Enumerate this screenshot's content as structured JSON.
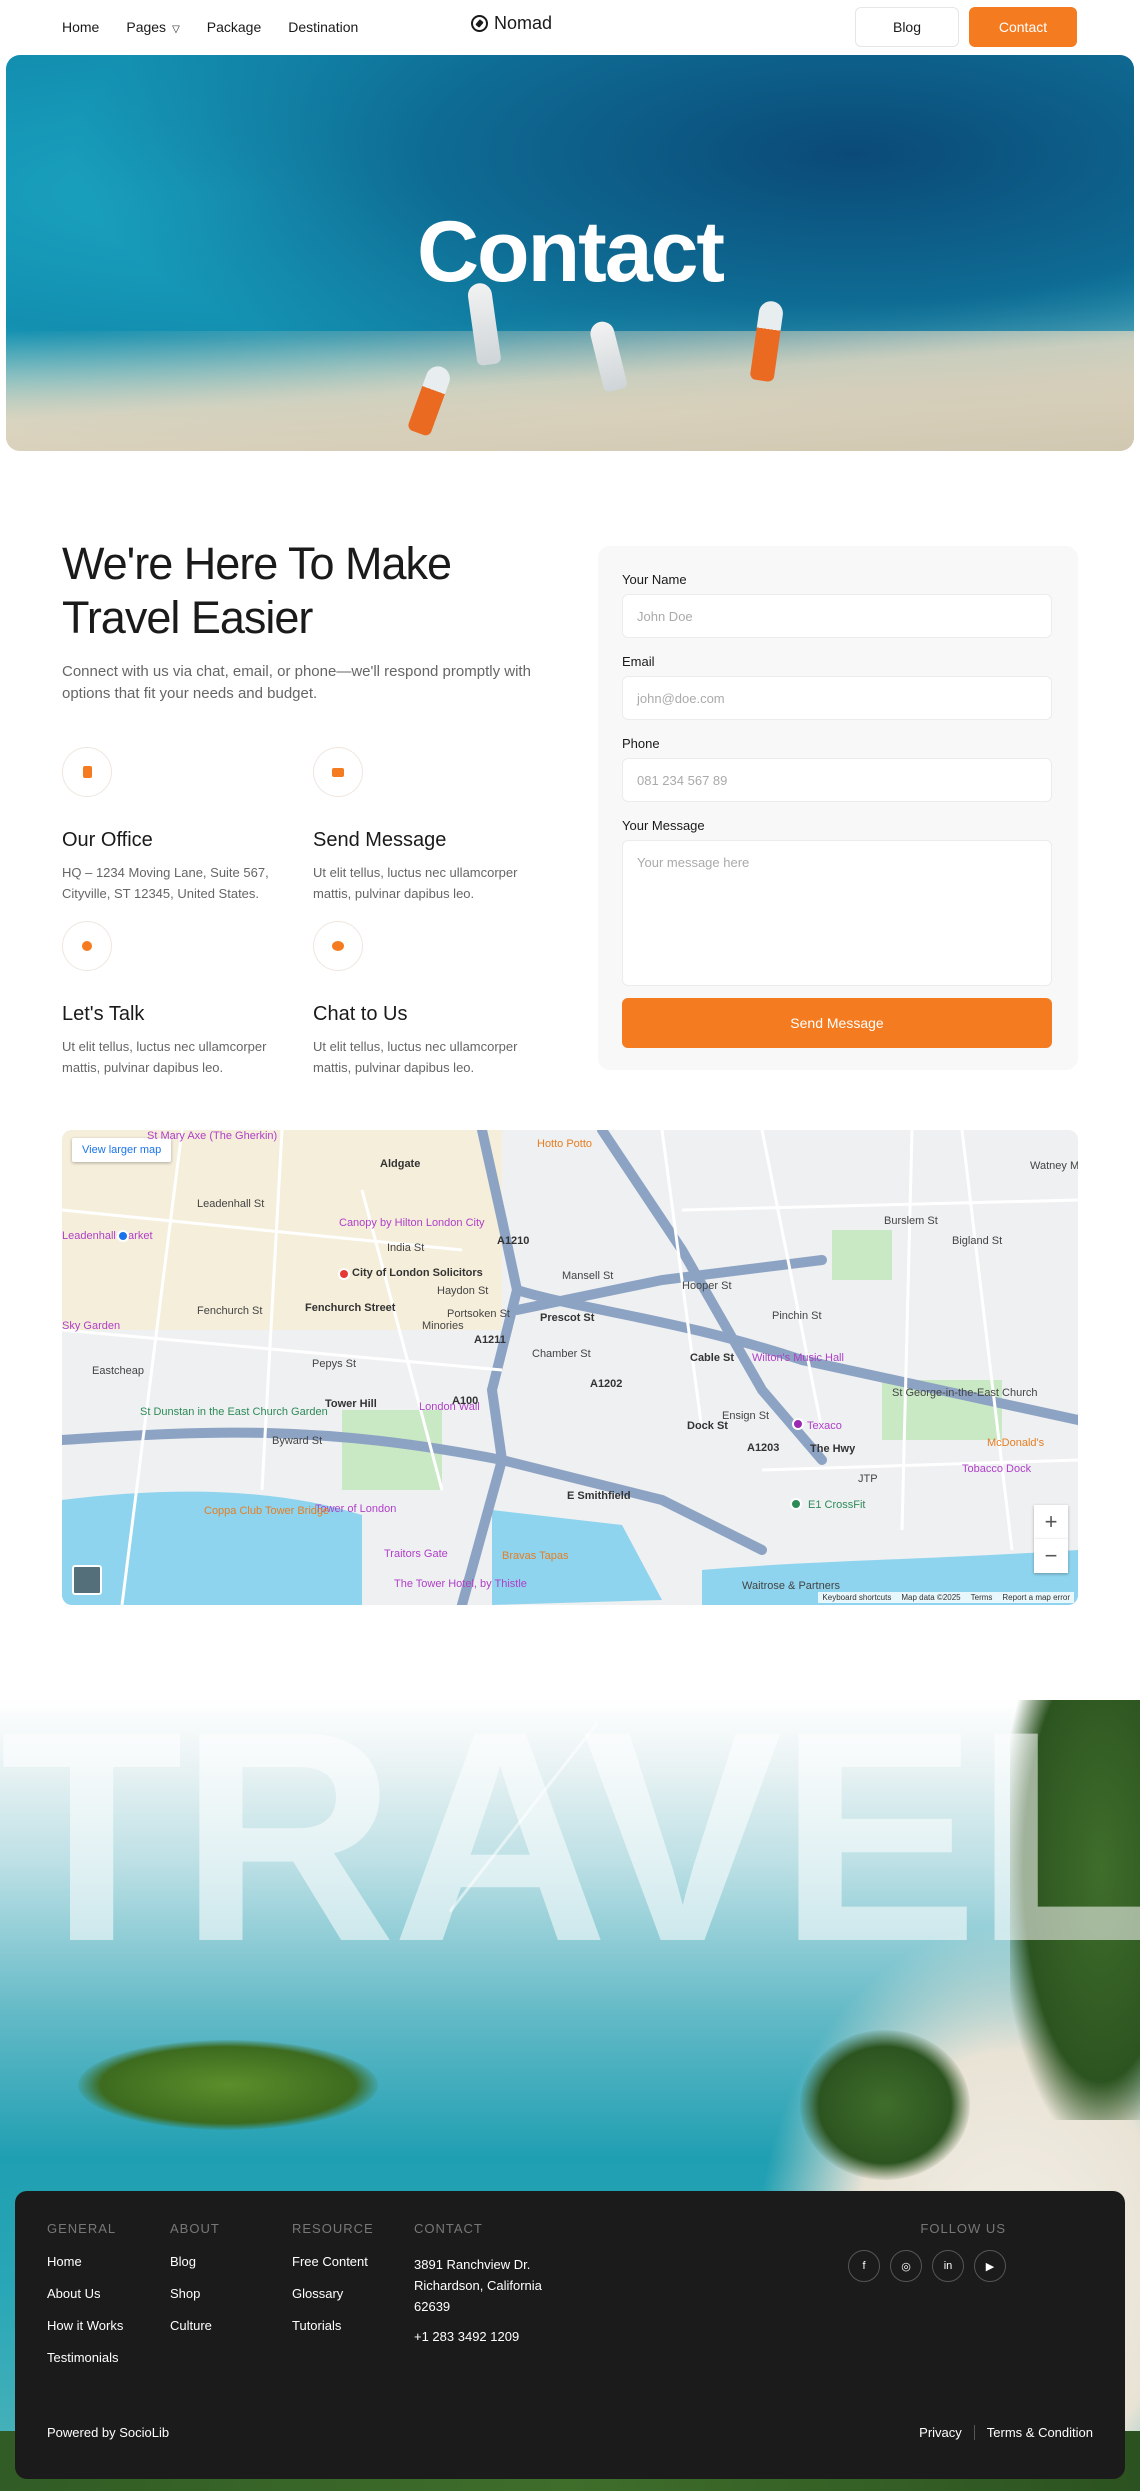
{
  "nav": {
    "links": [
      "Home",
      "Pages",
      "Package",
      "Destination"
    ],
    "active": "Pages",
    "logo": "Nomad",
    "blog": "Blog",
    "contact": "Contact"
  },
  "hero": {
    "title": "Contact"
  },
  "contact": {
    "heading": "We're Here To Make Travel Easier",
    "intro": "Connect with us via chat, email, or phone—we'll respond promptly with options that fit your needs and budget.",
    "cards": [
      {
        "title": "Our Office",
        "text": "HQ – 1234 Moving Lane, Suite 567, Cityville, ST 12345, United States.",
        "icon": "building-icon"
      },
      {
        "title": "Send Message",
        "text": "Ut elit tellus, luctus nec ullamcorper mattis, pulvinar dapibus leo.",
        "icon": "envelope-icon"
      },
      {
        "title": "Let's Talk",
        "text": "Ut elit tellus, luctus nec ullamcorper mattis, pulvinar dapibus leo.",
        "icon": "phone-icon"
      },
      {
        "title": "Chat to Us",
        "text": "Ut elit tellus, luctus nec ullamcorper mattis, pulvinar dapibus leo.",
        "icon": "chat-icon"
      }
    ]
  },
  "form": {
    "name_label": "Your Name",
    "name_placeholder": "John Doe",
    "email_label": "Email",
    "email_placeholder": "john@doe.com",
    "phone_label": "Phone",
    "phone_placeholder": "081 234 567 89",
    "message_label": "Your Message",
    "message_placeholder": "Your message here",
    "submit": "Send Message"
  },
  "map": {
    "larger": "View larger map",
    "zoom_in": "+",
    "zoom_out": "−",
    "attribution": [
      "Keyboard shortcuts",
      "Map data ©2025",
      "Terms",
      "Report a map error"
    ],
    "labels": [
      "St Mary Axe (The Gherkin)",
      "Aldgate",
      "Hotto Potto",
      "Leadenhall St",
      "Canopy by Hilton London City",
      "City of London Solicitors",
      "India St",
      "Fenchurch Street",
      "Sky Garden",
      "Eastcheap",
      "St Dunstan in the East Church Garden",
      "Tower Hill",
      "London Wall",
      "Tower of London",
      "Coppa Club Tower Bridge",
      "Traitors Gate",
      "The Tower Hotel, by Thistle",
      "Bravas Tapas",
      "Wilton's Music Hall",
      "St George-in-the-East Church",
      "McDonald's",
      "Texaco",
      "Tobacco Dock",
      "E1 CrossFit",
      "Waitrose & Partners",
      "Cable St",
      "The Hwy",
      "E Smithfield",
      "Prescot St",
      "Chamber St",
      "Minories",
      "Mansell St",
      "A1202",
      "A1203",
      "A1210",
      "A100",
      "A1211",
      "Watney M",
      "Burslem St",
      "Bigland St",
      "Fenchurch St",
      "Pepys St",
      "Byward St",
      "Hooper St",
      "Pinchin St",
      "Leadenhall Market",
      "JTP",
      "Dock St",
      "Ensign St",
      "Portsoken St",
      "Haydon St"
    ]
  },
  "travel": {
    "word": "TRAVEL"
  },
  "footer": {
    "general": {
      "heading": "GENERAL",
      "items": [
        "Home",
        "About Us",
        "How it Works",
        "Testimonials"
      ]
    },
    "about": {
      "heading": "ABOUT",
      "items": [
        "Blog",
        "Shop",
        "Culture"
      ]
    },
    "resource": {
      "heading": "RESOURCE",
      "items": [
        "Free Content",
        "Glossary",
        "Tutorials"
      ]
    },
    "contact": {
      "heading": "CONTACT",
      "address": "3891 Ranchview Dr. Richardson, California 62639",
      "phone": "+1 283 3492 1209"
    },
    "follow": {
      "heading": "FOLLOW US",
      "icons": [
        "facebook-icon",
        "instagram-icon",
        "linkedin-icon",
        "youtube-icon"
      ],
      "glyphs": [
        "f",
        "◎",
        "in",
        "▶"
      ]
    },
    "powered": "Powered by SocioLib",
    "privacy": "Privacy",
    "terms": "Terms & Condition"
  },
  "colors": {
    "accent": "#f47b20",
    "footer_bg": "#1b1b1b"
  }
}
